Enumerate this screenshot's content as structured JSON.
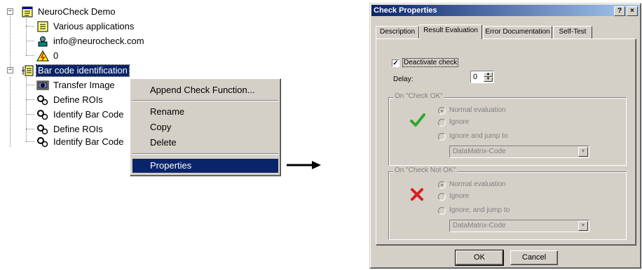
{
  "tree": {
    "root_label": "NeuroCheck Demo",
    "root_children": [
      "Various applications",
      "info@neurocheck.com",
      "0"
    ],
    "check_label": "Bar code identification",
    "check_children": [
      "Transfer Image",
      "Define ROIs",
      "Identify Bar Code",
      "Define ROIs",
      "Identify Bar Code"
    ],
    "expand_glyph": "−"
  },
  "context_menu": {
    "items": [
      "Append Check Function...",
      "Rename",
      "Copy",
      "Delete",
      "Properties"
    ],
    "highlighted": "Properties"
  },
  "dialog": {
    "title": "Check Properties",
    "help_glyph": "?",
    "close_glyph": "×",
    "tabs": [
      "Description",
      "Result Evaluation",
      "Error Documentation",
      "Self-Test"
    ],
    "active_tab": "Result Evaluation",
    "deactivate_label": "Deactivate check",
    "deactivate_checked": true,
    "check_glyph": "✓",
    "delay_label": "Delay:",
    "delay_value": "0",
    "ok_group": {
      "title": "On \"Check OK\"",
      "options": [
        "Normal evaluation",
        "Ignore",
        "Ignore and jump to"
      ],
      "combo_value": "DataMatrix-Code",
      "status_color": "#2fa82f"
    },
    "notok_group": {
      "title": "On \"Check Not OK\"",
      "options": [
        "Normal evaluation",
        "Ignore",
        "Ignore, and jump to"
      ],
      "combo_value": "DataMatrix-Code",
      "status_color": "#d81e1e"
    },
    "ok_button": "OK",
    "cancel_button": "Cancel"
  },
  "colors": {
    "selection": "#0a246a",
    "face": "#d4d0c8",
    "title_gradient_end": "#a6caf0"
  }
}
